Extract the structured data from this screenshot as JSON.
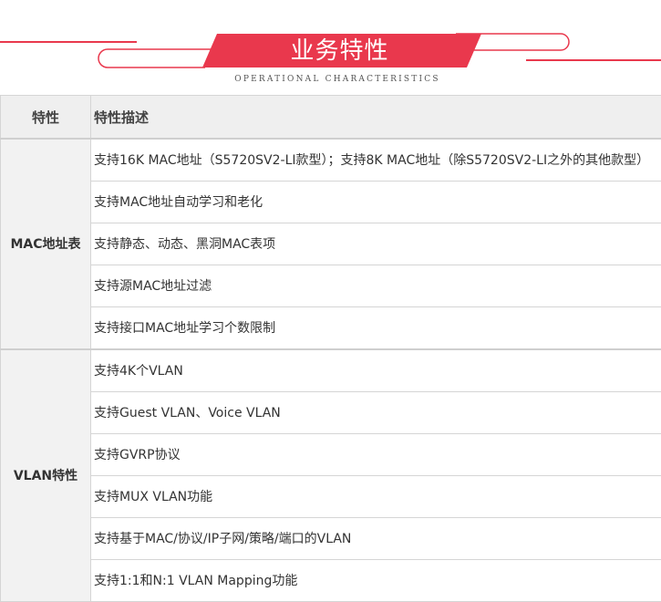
{
  "header": {
    "title": "业务特性",
    "subtitle": "OPERATIONAL CHARACTERISTICS",
    "accent_color": "#e9384d"
  },
  "table": {
    "columns": [
      "特性",
      "特性描述"
    ],
    "groups": [
      {
        "category": "MAC地址表",
        "items": [
          "支持16K MAC地址（S5720SV2-LI款型）；支持8K MAC地址（除S5720SV2-LI之外的其他款型）",
          "支持MAC地址自动学习和老化",
          "支持静态、动态、黑洞MAC表项",
          "支持源MAC地址过滤",
          "支持接口MAC地址学习个数限制"
        ]
      },
      {
        "category": "VLAN特性",
        "items": [
          "支持4K个VLAN",
          "支持Guest VLAN、Voice VLAN",
          "支持GVRP协议",
          "支持MUX VLAN功能",
          "支持基于MAC/协议/IP子网/策略/端口的VLAN",
          "支持1:1和N:1 VLAN Mapping功能"
        ]
      }
    ]
  }
}
